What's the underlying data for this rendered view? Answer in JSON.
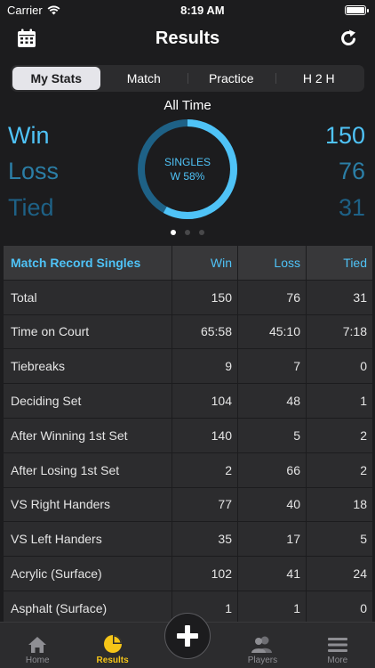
{
  "status": {
    "carrier": "Carrier",
    "time": "8:19 AM"
  },
  "nav": {
    "title": "Results"
  },
  "tabs": [
    {
      "label": "My Stats",
      "active": true
    },
    {
      "label": "Match",
      "active": false
    },
    {
      "label": "Practice",
      "active": false
    },
    {
      "label": "H 2 H",
      "active": false
    }
  ],
  "summary": {
    "title": "All Time",
    "win_label": "Win",
    "win_value": "150",
    "loss_label": "Loss",
    "loss_value": "76",
    "tied_label": "Tied",
    "tied_value": "31",
    "donut_line1": "SINGLES",
    "donut_line2": "W 58%",
    "win_percent": 58,
    "colors": {
      "win": "#4fc3f7",
      "loss": "#2b7ea6",
      "tied": "#1e6186"
    }
  },
  "table": {
    "headers": [
      "Match Record Singles",
      "Win",
      "Loss",
      "Tied"
    ],
    "rows": [
      [
        "Total",
        "150",
        "76",
        "31"
      ],
      [
        "Time on Court",
        "65:58",
        "45:10",
        "7:18"
      ],
      [
        "Tiebreaks",
        "9",
        "7",
        "0"
      ],
      [
        "Deciding Set",
        "104",
        "48",
        "1"
      ],
      [
        "After Winning 1st Set",
        "140",
        "5",
        "2"
      ],
      [
        "After Losing 1st Set",
        "2",
        "66",
        "2"
      ],
      [
        "VS Right Handers",
        "77",
        "40",
        "18"
      ],
      [
        "VS Left Handers",
        "35",
        "17",
        "5"
      ],
      [
        "Acrylic (Surface)",
        "102",
        "41",
        "24"
      ],
      [
        "Asphalt (Surface)",
        "1",
        "1",
        "0"
      ]
    ]
  },
  "tabbar": {
    "home": "Home",
    "results": "Results",
    "players": "Players",
    "more": "More",
    "active_color": "#f5c518"
  }
}
